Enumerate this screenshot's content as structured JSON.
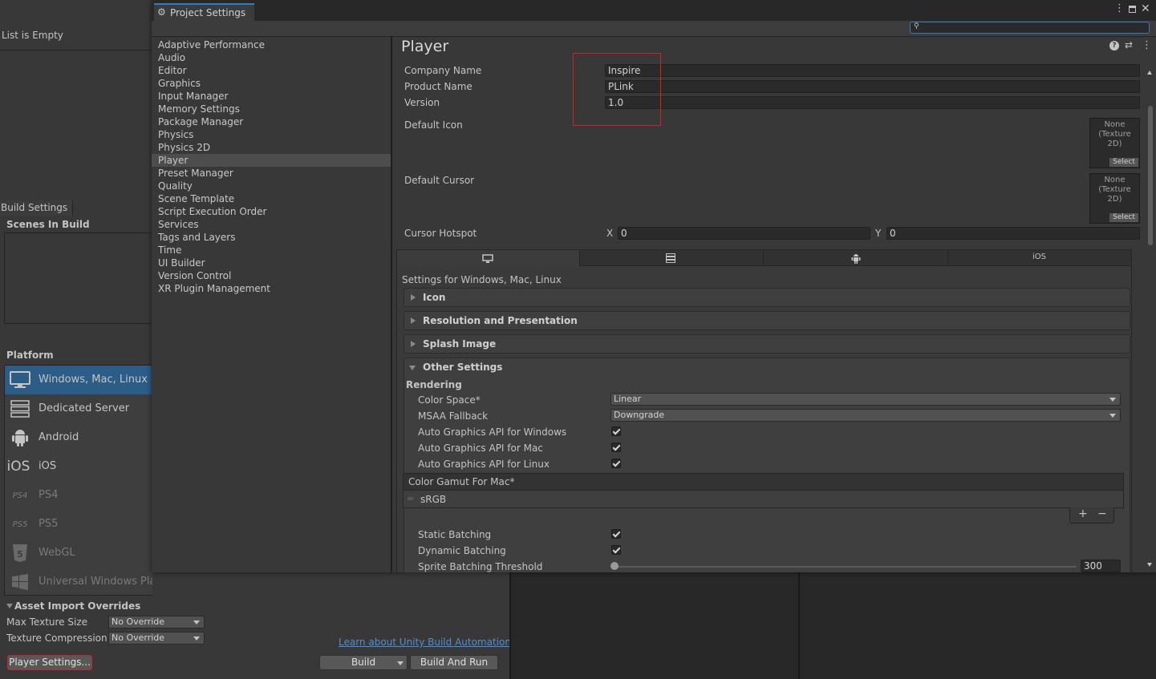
{
  "bg": {
    "list_empty": "List is Empty",
    "build_settings_tab": "Build Settings",
    "scenes_in_build": "Scenes In Build",
    "platform_header": "Platform",
    "platforms": [
      {
        "label": "Windows, Mac, Linux",
        "icon": "monitor-icon",
        "selected": true,
        "dim": false
      },
      {
        "label": "Dedicated Server",
        "icon": "server-icon",
        "selected": false,
        "dim": false
      },
      {
        "label": "Android",
        "icon": "android-icon",
        "selected": false,
        "dim": false
      },
      {
        "label": "iOS",
        "icon": "ios-icon",
        "icon_text": "iOS",
        "selected": false,
        "dim": false
      },
      {
        "label": "PS4",
        "icon": "ps4-icon",
        "icon_text": "PS4",
        "selected": false,
        "dim": true
      },
      {
        "label": "PS5",
        "icon": "ps5-icon",
        "icon_text": "PS5",
        "selected": false,
        "dim": true
      },
      {
        "label": "WebGL",
        "icon": "html5-icon",
        "icon_text": "5",
        "selected": false,
        "dim": true
      },
      {
        "label": "Universal Windows Platform",
        "icon": "windows-icon",
        "selected": false,
        "dim": true
      }
    ],
    "asset_import_overrides": "Asset Import Overrides",
    "max_texture_size_label": "Max Texture Size",
    "max_texture_size_value": "No Override",
    "texture_compression_label": "Texture Compression",
    "texture_compression_value": "No Override",
    "player_settings_button": "Player Settings...",
    "learn_link": "Learn about Unity Build Automation",
    "build_button": "Build",
    "build_and_run_button": "Build And Run"
  },
  "window": {
    "tab_title": "Project Settings",
    "search_placeholder": ""
  },
  "nav": {
    "items": [
      "Adaptive Performance",
      "Audio",
      "Editor",
      "Graphics",
      "Input Manager",
      "Memory Settings",
      "Package Manager",
      "Physics",
      "Physics 2D",
      "Player",
      "Preset Manager",
      "Quality",
      "Scene Template",
      "Script Execution Order",
      "Services",
      "Tags and Layers",
      "Time",
      "UI Builder",
      "Version Control",
      "XR Plugin Management"
    ],
    "selected": "Player"
  },
  "player": {
    "title": "Player",
    "company_name_label": "Company Name",
    "company_name": "Inspire",
    "product_name_label": "Product Name",
    "product_name": "PLink",
    "version_label": "Version",
    "version": "1.0",
    "default_icon_label": "Default Icon",
    "default_cursor_label": "Default Cursor",
    "texture_none": "None (Texture 2D)",
    "select_label": "Select",
    "cursor_hotspot_label": "Cursor Hotspot",
    "hotspot_x_label": "X",
    "hotspot_x": "0",
    "hotspot_y_label": "Y",
    "hotspot_y": "0",
    "platform_tabs": [
      {
        "icon": "monitor-icon"
      },
      {
        "icon": "server-icon"
      },
      {
        "icon": "android-icon"
      },
      {
        "text": "iOS"
      }
    ],
    "settings_for": "Settings for Windows, Mac, Linux",
    "sections": [
      "Icon",
      "Resolution and Presentation",
      "Splash Image",
      "Other Settings"
    ],
    "rendering_header": "Rendering",
    "color_space_label": "Color Space*",
    "color_space_value": "Linear",
    "msaa_label": "MSAA Fallback",
    "msaa_value": "Downgrade",
    "auto_windows_label": "Auto Graphics API  for Windows",
    "auto_mac_label": "Auto Graphics API  for Mac",
    "auto_linux_label": "Auto Graphics API  for Linux",
    "color_gamut_label": "Color Gamut For Mac*",
    "color_gamut_item": "sRGB",
    "static_batching_label": "Static Batching",
    "dynamic_batching_label": "Dynamic Batching",
    "sprite_threshold_label": "Sprite Batching Threshold",
    "sprite_threshold_value": "300"
  },
  "colors": {
    "highlight_box": "#d42020",
    "selection": "#2c5d87",
    "link": "#4c8fd6"
  }
}
